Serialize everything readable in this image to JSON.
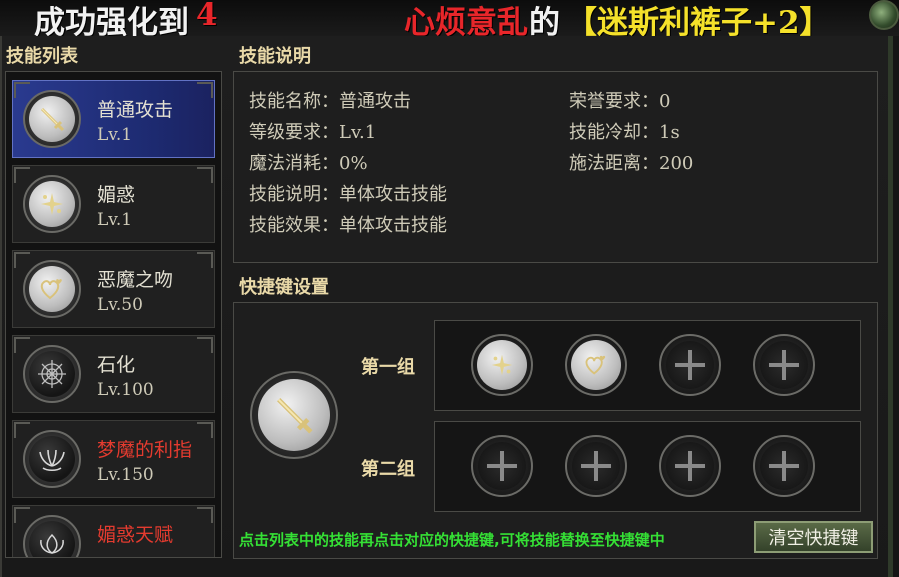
{
  "banner": {
    "left_text": "成功强化到",
    "left_number": "4",
    "target_name": "心烦意乱",
    "mid_text": "的",
    "item_text": "【迷斯利裤子+2】",
    "colors": {
      "white": "#f2f2f2",
      "red": "#e8262a",
      "yellow": "#f5e12a"
    }
  },
  "skill_list": {
    "title": "技能列表",
    "items": [
      {
        "name": "普通攻击",
        "level": "Lv.1",
        "icon": "sword-icon",
        "selected": true,
        "color": "normal"
      },
      {
        "name": "媚惑",
        "level": "Lv.1",
        "icon": "sparkle-icon",
        "selected": false,
        "color": "normal"
      },
      {
        "name": "恶魔之吻",
        "level": "Lv.50",
        "icon": "heart-icon",
        "selected": false,
        "color": "normal"
      },
      {
        "name": "石化",
        "level": "Lv.100",
        "icon": "web-icon",
        "selected": false,
        "color": "normal"
      },
      {
        "name": "梦魔的利指",
        "level": "Lv.150",
        "icon": "claw-icon",
        "selected": false,
        "color": "red"
      },
      {
        "name": "媚惑天赋",
        "level": "",
        "icon": "lotus-icon",
        "selected": false,
        "color": "red"
      }
    ]
  },
  "skill_desc": {
    "title": "技能说明",
    "name_label": "技能名称：",
    "name_value": "普通攻击",
    "level_label": "等级要求：",
    "level_value": "Lv.1",
    "mana_label": "魔法消耗：",
    "mana_value": "0%",
    "desc_label": "技能说明：",
    "desc_value": "单体攻击技能",
    "effect_label": "技能效果：",
    "effect_value": "单体攻击技能",
    "honor_label": "荣誉要求：",
    "honor_value": "0",
    "cooldown_label": "技能冷却：",
    "cooldown_value": "1s",
    "range_label": "施法距离：",
    "range_value": "200"
  },
  "hotkey": {
    "title": "快捷键设置",
    "group1_label": "第一组",
    "group2_label": "第二组",
    "group1_slots": [
      "sparkle-icon",
      "heart-icon",
      "empty",
      "empty"
    ],
    "group2_slots": [
      "empty",
      "empty",
      "empty",
      "empty"
    ],
    "hint": "点击列表中的技能再点击对应的快捷键,可将技能替换至快捷键中",
    "clear_label": "清空快捷键"
  }
}
